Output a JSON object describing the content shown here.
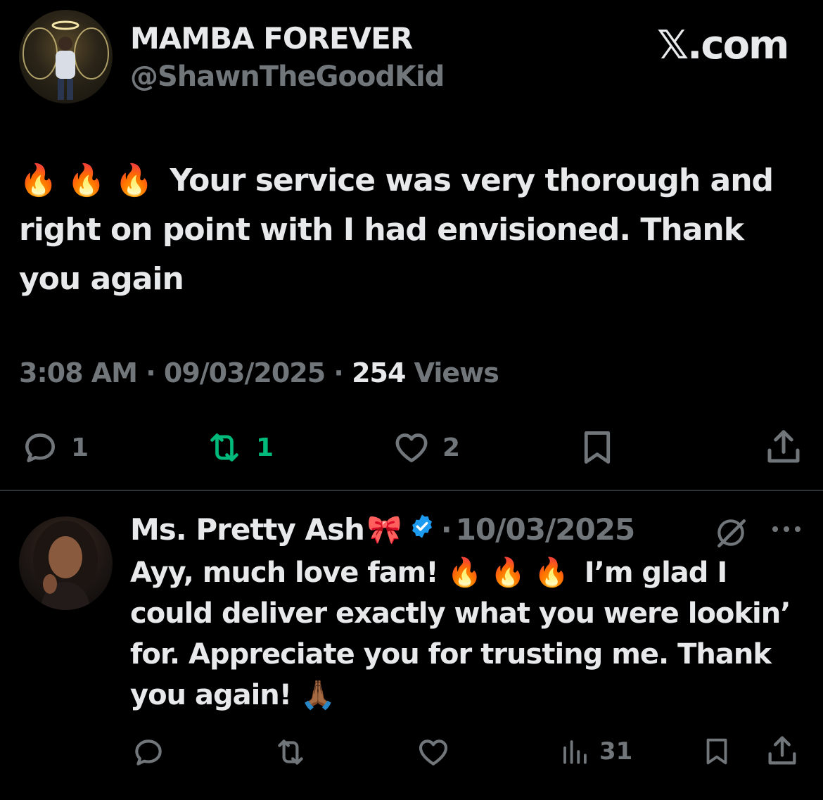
{
  "watermark": {
    "logo": "𝕏.com"
  },
  "tweet": {
    "author_name": "MAMBA FOREVER",
    "author_handle": "@ShawnTheGoodKid",
    "emoji_prefix": "🔥 🔥 🔥",
    "text": "Your service was very thorough and right on point with I had envisioned. Thank you again",
    "time": "3:08 AM",
    "date": "09/03/2025",
    "views_count": "254",
    "views_label": "Views",
    "actions": {
      "replies": "1",
      "retweets": "1",
      "likes": "2"
    },
    "icons": [
      "reply-icon",
      "retweet-icon",
      "like-icon",
      "bookmark-icon",
      "share-icon"
    ],
    "colors": {
      "retweet_active": "#00ba7c",
      "muted": "#71767b",
      "text": "#e7e9ea",
      "verified": "#1d9bf0"
    }
  },
  "reply": {
    "author_name": "Ms. Pretty Ash",
    "name_emoji": "🎀",
    "date": "10/03/2025",
    "text_part1": "Ayy, much love fam!",
    "emoji_mid": "🔥 🔥 🔥",
    "text_part2": "I’m glad I could deliver exactly what you were lookin’ for. Appreciate you for trusting me. Thank you again!",
    "emoji_end": "🙏🏾",
    "views": "31",
    "icons": [
      "reply-icon",
      "retweet-icon",
      "like-icon",
      "views-icon",
      "bookmark-icon",
      "share-icon"
    ]
  }
}
